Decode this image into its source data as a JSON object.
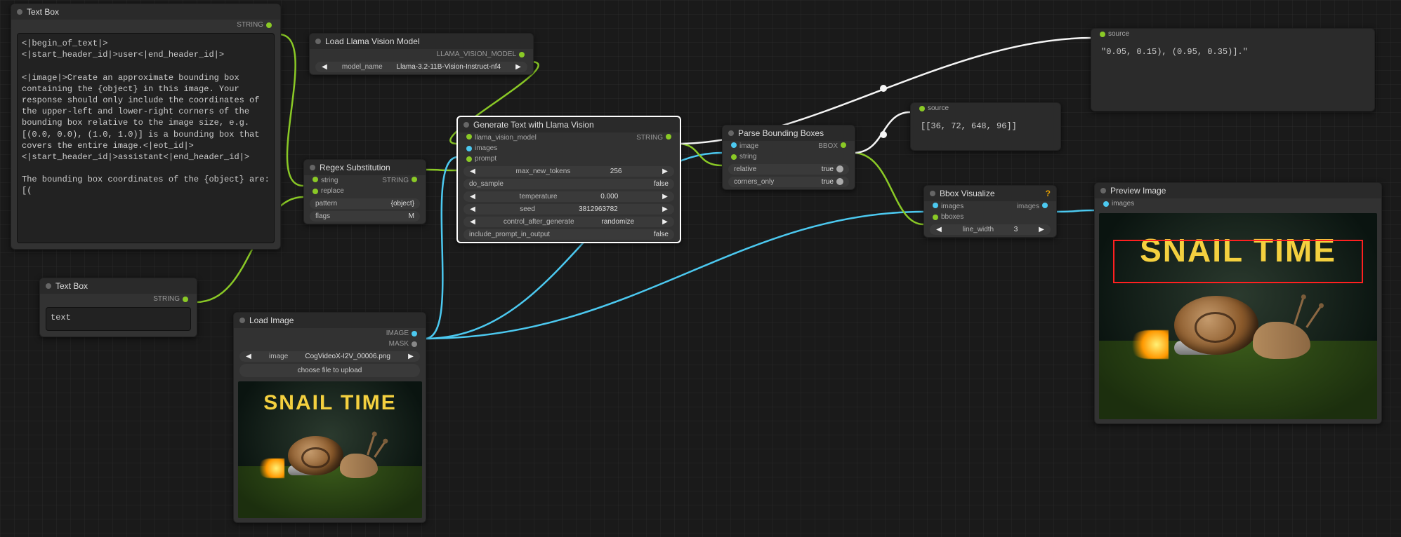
{
  "nodes": {
    "textbox1": {
      "title": "Text Box",
      "out_type": "STRING",
      "text": "<|begin_of_text|>\n<|start_header_id|>user<|end_header_id|>\n\n<|image|>Create an approximate bounding box containing the {object} in this image. Your response should only include the coordinates of the upper-left and lower-right corners of the bounding box relative to the image size, e.g. [(0.0, 0.0), (1.0, 1.0)] is a bounding box that covers the entire image.<|eot_id|>\n<|start_header_id|>assistant<|end_header_id|>\n\nThe bounding box coordinates of the {object} are: [("
    },
    "textbox2": {
      "title": "Text Box",
      "out_type": "STRING",
      "text": "text"
    },
    "llama_model": {
      "title": "Load Llama Vision Model",
      "out_type": "LLAMA_VISION_MODEL",
      "widget_model_name_label": "model_name",
      "widget_model_name_value": "Llama-3.2-11B-Vision-Instruct-nf4"
    },
    "regex": {
      "title": "Regex Substitution",
      "out_type": "STRING",
      "in_string": "string",
      "in_replace": "replace",
      "w_pattern_label": "pattern",
      "w_pattern_value": "{object}",
      "w_flags_label": "flags",
      "w_flags_value": "M"
    },
    "load_image": {
      "title": "Load Image",
      "out_image": "IMAGE",
      "out_mask": "MASK",
      "w_image_label": "image",
      "w_image_value": "CogVideoX-I2V_00006.png",
      "btn_choose": "choose file to upload",
      "overlay_text": "SNAIL TIME"
    },
    "gen_text": {
      "title": "Generate Text with Llama Vision",
      "out_type": "STRING",
      "in_model": "llama_vision_model",
      "in_images": "images",
      "in_prompt": "prompt",
      "w_max_tokens_label": "max_new_tokens",
      "w_max_tokens_value": "256",
      "w_do_sample_label": "do_sample",
      "w_do_sample_value": "false",
      "w_temperature_label": "temperature",
      "w_temperature_value": "0.000",
      "w_seed_label": "seed",
      "w_seed_value": "3812963782",
      "w_ctrl_label": "control_after_generate",
      "w_ctrl_value": "randomize",
      "w_incl_label": "include_prompt_in_output",
      "w_incl_value": "false"
    },
    "parse_bbox": {
      "title": "Parse Bounding Boxes",
      "out_type": "BBOX",
      "in_image": "image",
      "in_string": "string",
      "w_relative_label": "relative",
      "w_relative_value": "true",
      "w_corners_label": "corners_only",
      "w_corners_value": "true"
    },
    "bbox_vis": {
      "title": "Bbox Visualize",
      "out_images": "images",
      "in_images": "images",
      "in_bboxes": "bboxes",
      "w_line_label": "line_width",
      "w_line_value": "3",
      "warning": "?"
    },
    "source1": {
      "label": "source",
      "text": "\"0.05, 0.15), (0.95, 0.35)].\""
    },
    "source2": {
      "label": "source",
      "text": "[[36, 72, 648, 96]]"
    },
    "preview": {
      "title": "Preview Image",
      "in_images": "images",
      "overlay_text": "SNAIL TIME"
    }
  },
  "colors": {
    "wire_green": "#8ac926",
    "wire_blue": "#4cc9f0",
    "wire_white": "#f5f5f5",
    "wire_yellow": "#c9b458"
  }
}
